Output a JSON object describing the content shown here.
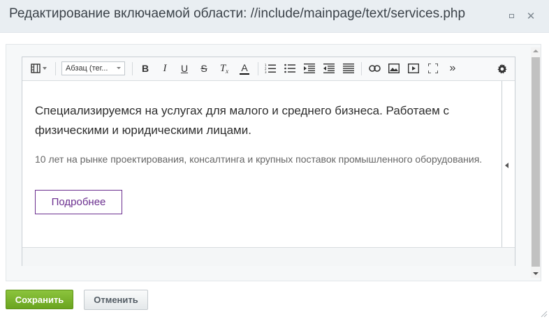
{
  "window": {
    "title": "Редактирование включаемой области: //include/mainpage/text/services.php",
    "maximize_icon": "maximize-icon",
    "close_icon": "close-icon"
  },
  "toolbar": {
    "format_select_value": "Абзац (тег...",
    "buttons": [
      "film-strip-icon",
      "bold-icon",
      "italic-icon",
      "underline-icon",
      "strikethrough-icon",
      "clear-format-icon",
      "font-color-icon",
      "ordered-list-icon",
      "unordered-list-icon",
      "outdent-icon",
      "indent-icon",
      "align-icon",
      "link-icon",
      "image-icon",
      "video-icon",
      "fullscreen-icon",
      "more-icon",
      "settings-icon"
    ],
    "bold_label": "B",
    "italic_label": "I",
    "underline_label": "U",
    "strike_label": "S",
    "clear_label": "T",
    "color_label": "A",
    "font_color": "#cc0000",
    "more_label": "»"
  },
  "content": {
    "lead_line1": "Специализируемся на услугах для малого и среднего бизнеса. Работаем с",
    "lead_line2": "физическими и юридическими лицами.",
    "sub_text": "10 лет на рынке проектирования, консалтинга и крупных поставок промышленного оборудования.",
    "more_button": "Подробнее",
    "accent_color": "#6b2f8f"
  },
  "footer": {
    "save_label": "Сохранить",
    "cancel_label": "Отменить",
    "save_color": "#7ab32e"
  }
}
